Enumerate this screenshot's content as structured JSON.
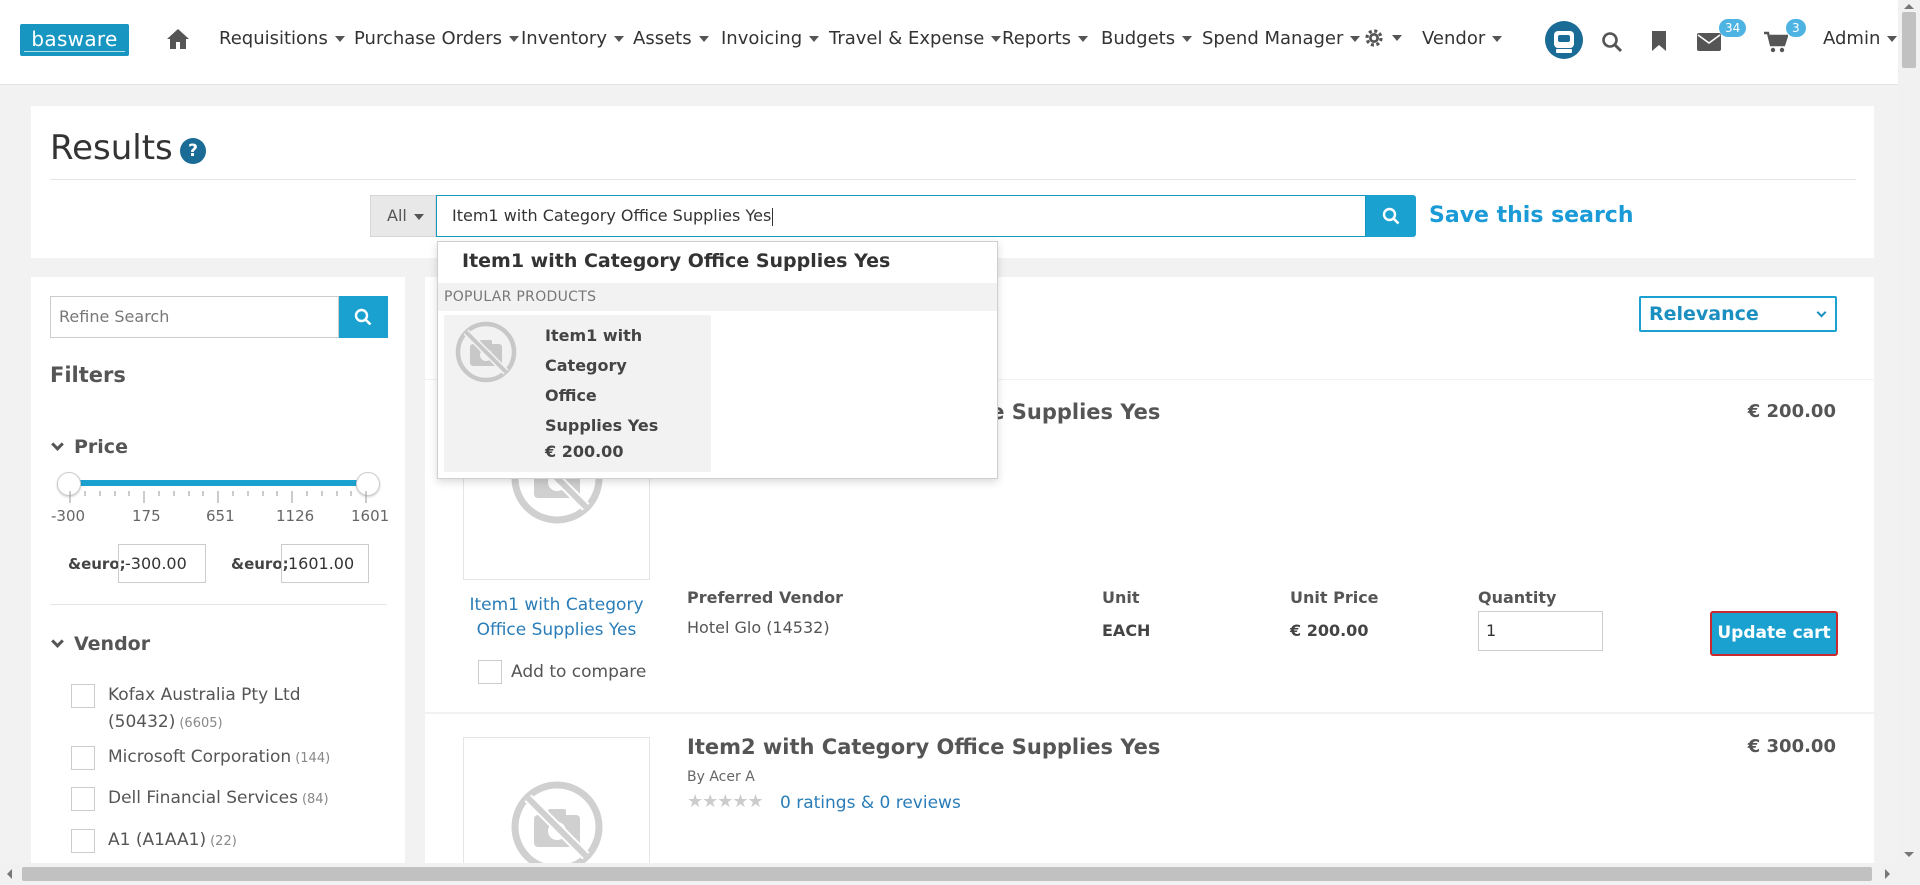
{
  "nav": {
    "logo": "basware",
    "items": [
      {
        "label": "Requisitions"
      },
      {
        "label": "Purchase Orders"
      },
      {
        "label": "Inventory"
      },
      {
        "label": "Assets"
      },
      {
        "label": "Invoicing"
      },
      {
        "label": "Travel & Expense"
      },
      {
        "label": "Reports"
      },
      {
        "label": "Budgets"
      },
      {
        "label": "Spend Manager"
      },
      {
        "label": "Vendor"
      }
    ],
    "messages_count": "34",
    "cart_count": "3",
    "user_label": "Admin",
    "icons": [
      "home-icon",
      "gear-icon",
      "assistant-icon",
      "search-icon",
      "bookmark-icon",
      "envelope-icon",
      "cart-icon"
    ]
  },
  "results": {
    "title": "Results",
    "help": "?",
    "scope_label": "All",
    "search_value": "Item1 with Category Office Supplies Yes",
    "save_search_label": "Save this search"
  },
  "autocomplete": {
    "suggestion": "Item1 with Category Office Supplies Yes",
    "popular_header": "POPULAR PRODUCTS",
    "popular": [
      {
        "name_lines": [
          "Item1 with",
          "Category",
          "Office",
          "Supplies Yes"
        ],
        "price": "€ 200.00"
      }
    ]
  },
  "sidebar": {
    "refine_placeholder": "Refine Search",
    "filters_title": "Filters",
    "price": {
      "title": "Price",
      "range": [
        -300,
        1601
      ],
      "tick_labels": [
        "-300",
        "175",
        "651",
        "1126",
        "1601"
      ],
      "currency_label": "&euro;",
      "min_value": "-300.00",
      "max_value": "1601.00"
    },
    "vendor": {
      "title": "Vendor",
      "items": [
        {
          "name": "Kofax Australia Pty Ltd",
          "name2": "(50432)",
          "count": "(6605)"
        },
        {
          "name": "Microsoft Corporation",
          "count": "(144)"
        },
        {
          "name": "Dell Financial Services",
          "count": "(84)"
        },
        {
          "name": "A1 (A1AA1)",
          "count": "(22)"
        }
      ]
    }
  },
  "sort": {
    "selected": "Relevance"
  },
  "products": [
    {
      "name": "Item1 with Category Office Supplies Yes",
      "price": "€ 200.00",
      "image_link_lines": [
        "Item1 with Category",
        "Office Supplies Yes"
      ],
      "compare_label": "Add to compare",
      "vendor_header": "Preferred Vendor",
      "vendor": "Hotel Glo (14532)",
      "unit_header": "Unit",
      "unit": "EACH",
      "unit_price_header": "Unit Price",
      "unit_price": "€ 200.00",
      "quantity_header": "Quantity",
      "quantity": "1",
      "update_label": "Update cart"
    },
    {
      "name": "Item2 with Category Office Supplies Yes",
      "price": "€ 300.00",
      "by": "By Acer A",
      "ratings_label": "0 ratings & 0 reviews",
      "stars": "★★★★★"
    }
  ]
}
